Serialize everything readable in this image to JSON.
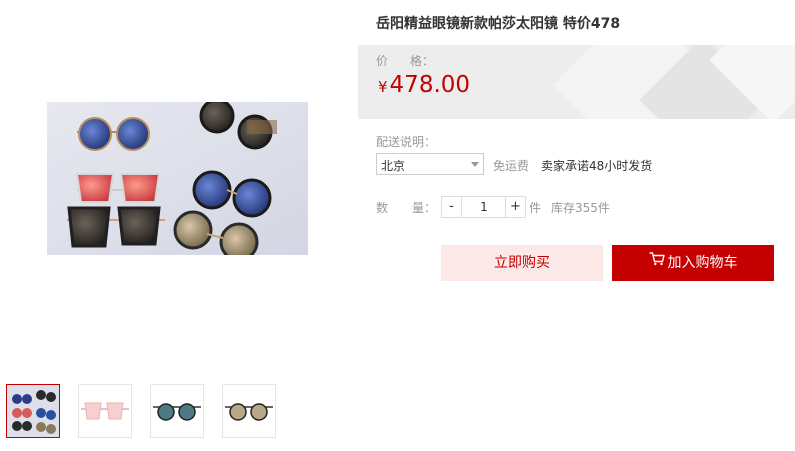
{
  "product": {
    "title": "岳阳精益眼镜新款帕莎太阳镜 特价478",
    "price_label": [
      "价",
      "格："
    ],
    "currency_symbol": "¥",
    "price": "478.00"
  },
  "shipping": {
    "label": "配送说明：",
    "region_selected": "北京",
    "free_shipping": "免运费",
    "promise": "卖家承诺48小时发货"
  },
  "quantity": {
    "label": [
      "数",
      "量："
    ],
    "minus": "-",
    "value": "1",
    "plus": "+",
    "unit": "件",
    "stock": "库存355件"
  },
  "actions": {
    "buy_now": "立即购买",
    "add_to_cart": "加入购物车"
  },
  "icons": {
    "cart": "shopping-cart-icon",
    "dropdown": "chevron-down-icon"
  },
  "colors": {
    "accent": "#c40000",
    "buy_now_bg": "#fde8e8",
    "price_bg": "#ededed"
  },
  "thumbnails": [
    {
      "alt": "thumbnail-1",
      "active": true
    },
    {
      "alt": "thumbnail-2",
      "active": false
    },
    {
      "alt": "thumbnail-3",
      "active": false
    },
    {
      "alt": "thumbnail-4",
      "active": false
    }
  ]
}
